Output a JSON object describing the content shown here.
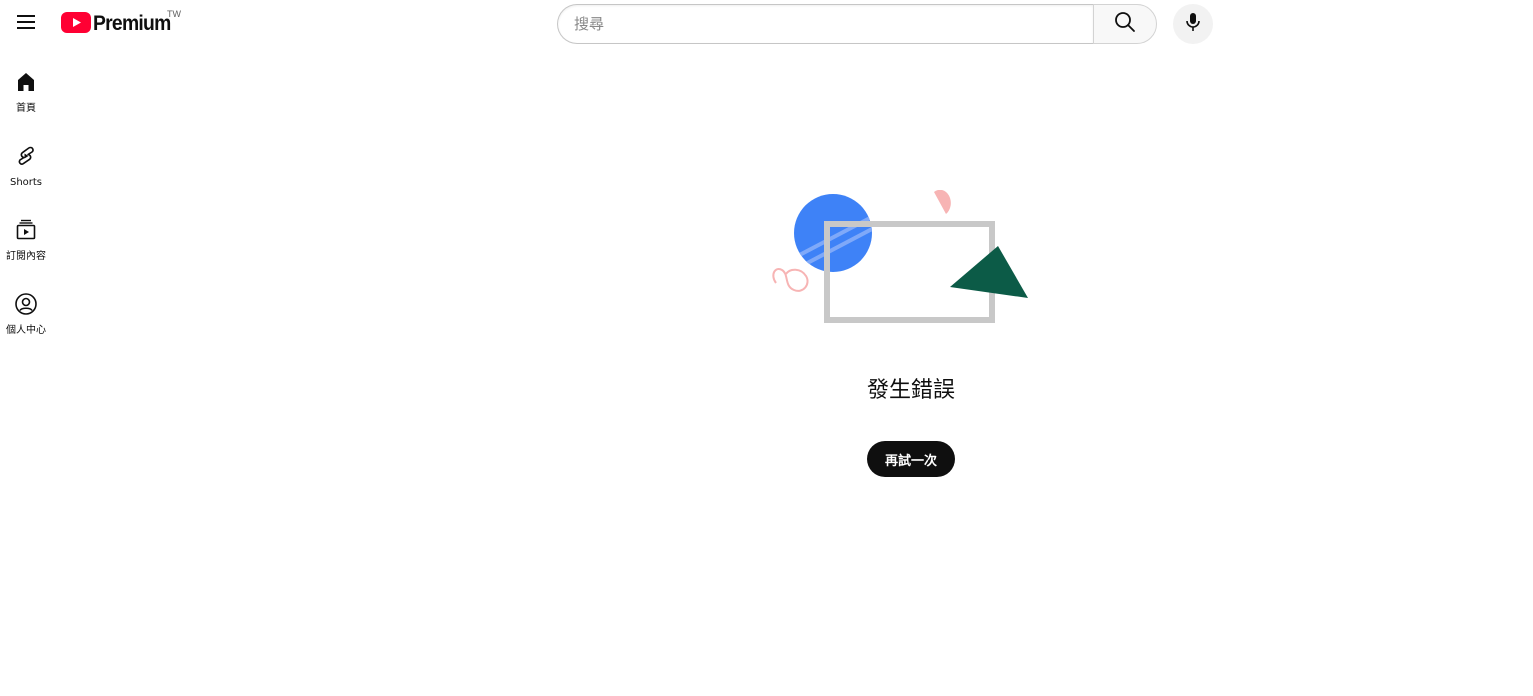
{
  "header": {
    "logo_text": "Premium",
    "logo_country": "TW",
    "search_placeholder": "搜尋",
    "menu_icon": "hamburger-menu-icon",
    "search_icon": "search-icon",
    "mic_icon": "microphone-icon",
    "brand_color": "#ff0033"
  },
  "sidebar": {
    "items": [
      {
        "label": "首頁",
        "icon": "home-icon"
      },
      {
        "label": "Shorts",
        "icon": "shorts-icon"
      },
      {
        "label": "訂閱內容",
        "icon": "subscriptions-icon"
      },
      {
        "label": "個人中心",
        "icon": "account-icon"
      }
    ]
  },
  "error": {
    "title": "發生錯誤",
    "retry_label": "再試一次",
    "illustration_colors": {
      "circle": "#3e82f7",
      "frame": "#c8c8c8",
      "triangle": "#0c5b47",
      "accent": "#f7b4b4"
    }
  }
}
